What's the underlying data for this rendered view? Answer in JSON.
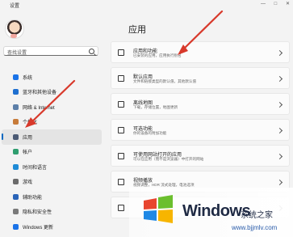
{
  "window": {
    "title": "设置",
    "controls": [
      "—",
      "□",
      "✕"
    ]
  },
  "search": {
    "placeholder": "查找设置"
  },
  "sidebar": {
    "items": [
      {
        "label": "系统",
        "icon": "system-icon",
        "color": "#1a73e8"
      },
      {
        "label": "蓝牙和其他设备",
        "icon": "bluetooth-icon",
        "color": "#1e6fd0"
      },
      {
        "label": "网络 & Internet",
        "icon": "network-icon",
        "color": "#5c7fa8"
      },
      {
        "label": "个性化",
        "icon": "personalization-icon",
        "color": "#c77b3a"
      },
      {
        "label": "应用",
        "icon": "apps-icon",
        "color": "#4b5a74",
        "active": true
      },
      {
        "label": "帐户",
        "icon": "account-icon",
        "color": "#2f9e6f"
      },
      {
        "label": "时间和语言",
        "icon": "time-language-icon",
        "color": "#1f8bd6"
      },
      {
        "label": "游戏",
        "icon": "gaming-icon",
        "color": "#6b6b6b"
      },
      {
        "label": "辅助功能",
        "icon": "accessibility-icon",
        "color": "#2a64b8"
      },
      {
        "label": "隐私和安全性",
        "icon": "privacy-icon",
        "color": "#7a7a7a"
      },
      {
        "label": "Windows 更新",
        "icon": "windows-update-icon",
        "color": "#1a73e8"
      }
    ]
  },
  "main": {
    "title": "应用",
    "cards": [
      {
        "title": "应用和功能",
        "subtitle": "已安装的应用，应用执行别名",
        "icon": "apps-features-icon"
      },
      {
        "title": "默认应用",
        "subtitle": "文件和链接类型的默认值，其他默认值",
        "icon": "default-apps-icon"
      },
      {
        "title": "离线地图",
        "subtitle": "下载，存储位置，地图更新",
        "icon": "offline-maps-icon"
      },
      {
        "title": "可选功能",
        "subtitle": "你的设备的附加功能",
        "icon": "optional-features-icon"
      },
      {
        "title": "可使用网站打开的应用",
        "subtitle": "可以在应用（而不是浏览器）中打开的网站",
        "icon": "websites-apps-icon"
      },
      {
        "title": "视频播放",
        "subtitle": "视频调整，HDR 流式处理，电池选项",
        "icon": "video-playback-icon"
      },
      {
        "title": "",
        "subtitle": "",
        "icon": "startup-icon"
      }
    ]
  },
  "watermark": {
    "brand": "Windows",
    "cn": "系统之家",
    "url": "www.bjjmlv.com"
  },
  "colors": {
    "accent": "#0067c0",
    "arrow": "#d8392b"
  }
}
